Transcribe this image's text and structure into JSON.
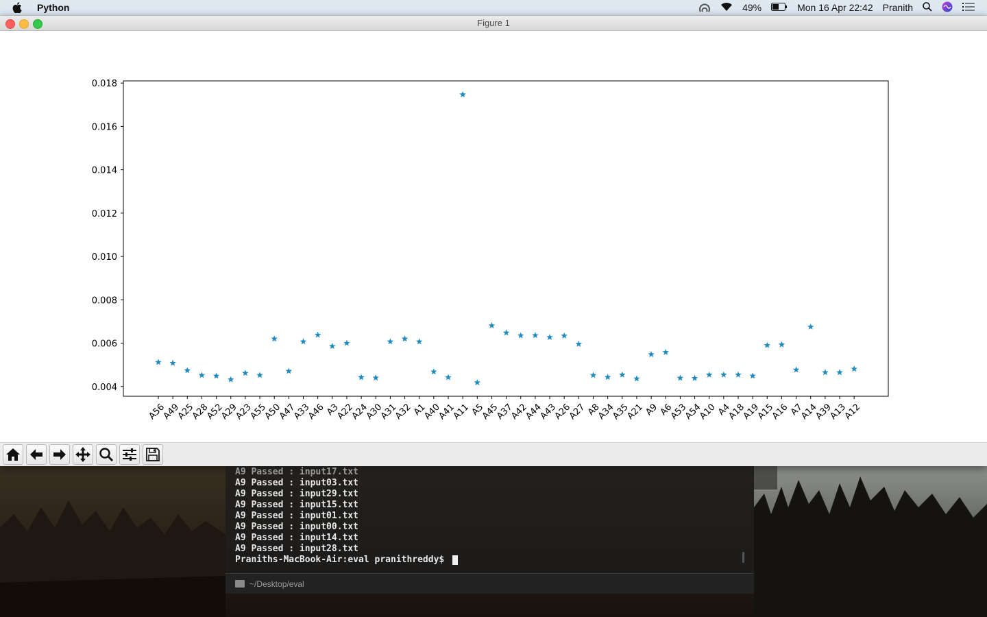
{
  "menubar": {
    "app_name": "Python",
    "battery": "49%",
    "datetime": "Mon 16 Apr  22:42",
    "user": "Pranith",
    "icons": [
      "apple-icon",
      "airdrop-icon",
      "wifi-icon",
      "battery-icon",
      "search-icon",
      "siri-icon",
      "notification-center-icon"
    ]
  },
  "window": {
    "title": "Figure 1"
  },
  "toolbar": {
    "buttons": [
      "home-icon",
      "back-icon",
      "forward-icon",
      "pan-icon",
      "zoom-icon",
      "configure-subplots-icon",
      "save-icon"
    ]
  },
  "chart_data": {
    "type": "scatter",
    "marker": "star",
    "color": "#1f8ac0",
    "title": "",
    "xlabel": "",
    "ylabel": "",
    "ylim": [
      0.00355,
      0.0181
    ],
    "yticks": [
      "0.004",
      "0.006",
      "0.008",
      "0.010",
      "0.012",
      "0.014",
      "0.016",
      "0.018"
    ],
    "ytick_values": [
      0.004,
      0.006,
      0.008,
      0.01,
      0.012,
      0.014,
      0.016,
      0.018
    ],
    "grid": false,
    "categories": [
      "A56",
      "A49",
      "A25",
      "A28",
      "A52",
      "A29",
      "A23",
      "A55",
      "A50",
      "A47",
      "A33",
      "A46",
      "A3",
      "A22",
      "A24",
      "A30",
      "A31",
      "A32",
      "A1",
      "A40",
      "A41",
      "A11",
      "A5",
      "A45",
      "A37",
      "A42",
      "A44",
      "A43",
      "A26",
      "A27",
      "A8",
      "A34",
      "A35",
      "A21",
      "A9",
      "A6",
      "A53",
      "A54",
      "A10",
      "A4",
      "A18",
      "A19",
      "A15",
      "A16",
      "A7",
      "A14",
      "A39",
      "A13",
      "A12"
    ],
    "values": [
      0.00512,
      0.00508,
      0.00474,
      0.00452,
      0.00449,
      0.00432,
      0.00462,
      0.00452,
      0.0062,
      0.00471,
      0.00607,
      0.00638,
      0.00586,
      0.006,
      0.00442,
      0.0044,
      0.00607,
      0.0062,
      0.00607,
      0.00468,
      0.00442,
      0.01747,
      0.00418,
      0.00681,
      0.00648,
      0.00635,
      0.00636,
      0.00627,
      0.00634,
      0.00596,
      0.00452,
      0.00443,
      0.00454,
      0.00436,
      0.00548,
      0.00558,
      0.00439,
      0.00438,
      0.00454,
      0.00454,
      0.00454,
      0.00449,
      0.0059,
      0.00593,
      0.00477,
      0.00675,
      0.00465,
      0.00465,
      0.00481
    ]
  },
  "terminal": {
    "lines": [
      "A9 Passed : input17.txt",
      "A9 Passed : input03.txt",
      "A9 Passed : input29.txt",
      "A9 Passed : input15.txt",
      "A9 Passed : input01.txt",
      "A9 Passed : input00.txt",
      "A9 Passed : input14.txt",
      "A9 Passed : input28.txt"
    ],
    "prompt": "Praniths-MacBook-Air:eval pranithreddy$ ",
    "cwd": "~/Desktop/eval"
  }
}
